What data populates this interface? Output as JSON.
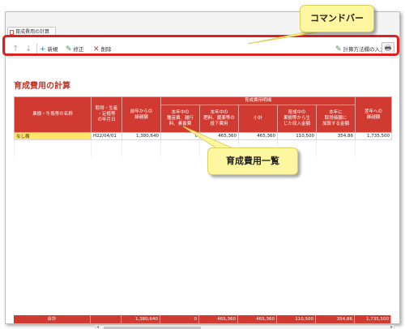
{
  "window": {
    "tab_label": "育成費用の計算"
  },
  "toolbar": {
    "up_arrow": "↑",
    "down_arrow": "↓",
    "new_icon": "+",
    "new_label": "新規",
    "edit_icon": "✎",
    "edit_label": "修正",
    "delete_icon": "✕",
    "delete_label": "削除",
    "calc_icon": "✎",
    "calc_label": "計算方法欄の入力",
    "print_icon": "🖶"
  },
  "page": {
    "title": "育成費用の計算"
  },
  "table": {
    "headers": {
      "name": "果樹・牛馬等の名称",
      "acquired": "取得・生産\n・定植等\nの年月日",
      "prior": "前年からの\n繰越額",
      "group": "育成費用明細",
      "seedling": "本年中の\n種苗費、雑行\n料、素畜費",
      "fertilizer": "本年中の\n肥料、農薬等の\n投下費用",
      "subtotal": "小計",
      "income": "育成中の\n果樹等から生\nじた収入金額",
      "transfer": "本年に\n取得価額に\n加算する金額",
      "carry": "翌年への\n繰越額"
    },
    "rows": [
      {
        "name": "なし樹",
        "date": "H22/04/01",
        "prior": "1,380,640",
        "seedling": "0",
        "fertilizer": "465,360",
        "subtotal": "465,360",
        "income": "110,500",
        "transfer": "354,86",
        "carry": "1,735,500"
      }
    ],
    "totals": {
      "label": "合計",
      "prior": "1,380,640",
      "seedling": "0",
      "fertilizer": "465,360",
      "subtotal": "465,360",
      "income": "110,500",
      "transfer": "354,86",
      "carry": "1,735,500"
    }
  },
  "callouts": {
    "command_bar": "コマンドバー",
    "list": "育成費用一覧"
  },
  "colors": {
    "accent": "#d03a30",
    "highlight": "#e02020",
    "callout": "#fff6a0",
    "selected_cell": "#ffe66b"
  }
}
